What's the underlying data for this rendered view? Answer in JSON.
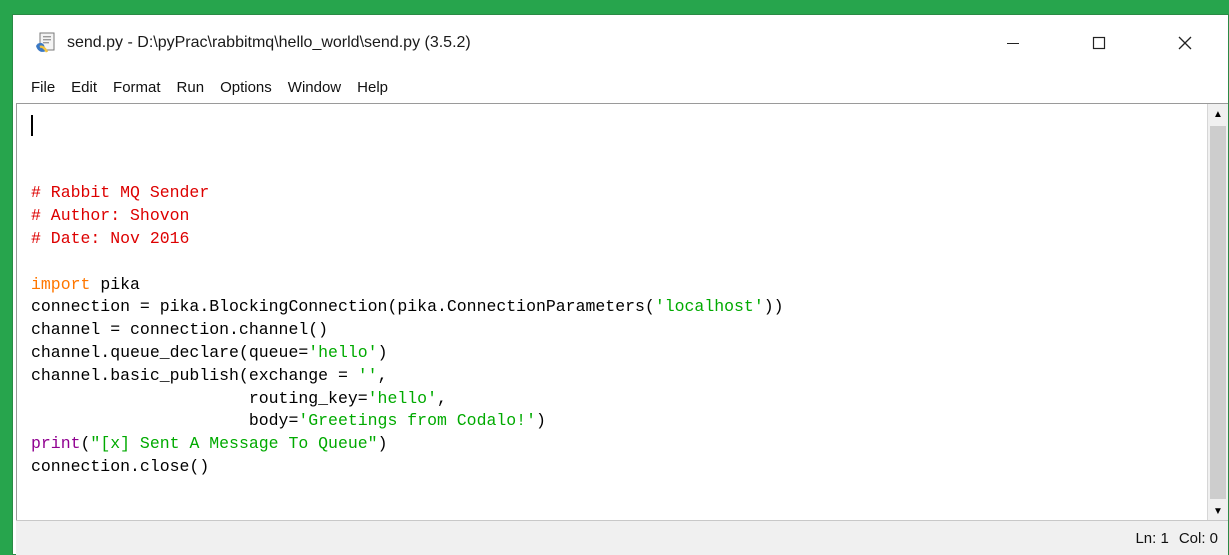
{
  "window": {
    "title": "send.py - D:\\pyPrac\\rabbitmq\\hello_world\\send.py (3.5.2)",
    "controls": {
      "minimize": "—",
      "maximize": "☐",
      "close": "✕"
    }
  },
  "menubar": {
    "items": [
      "File",
      "Edit",
      "Format",
      "Run",
      "Options",
      "Window",
      "Help"
    ]
  },
  "editor": {
    "lines": [
      [
        {
          "t": "# Rabbit MQ Sender",
          "c": "comment"
        }
      ],
      [
        {
          "t": "# Author: Shovon",
          "c": "comment"
        }
      ],
      [
        {
          "t": "# Date: Nov 2016",
          "c": "comment"
        }
      ],
      [
        {
          "t": "",
          "c": "plain"
        }
      ],
      [
        {
          "t": "import",
          "c": "keyword"
        },
        {
          "t": " pika",
          "c": "plain"
        }
      ],
      [
        {
          "t": "connection = pika.BlockingConnection(pika.ConnectionParameters(",
          "c": "plain"
        },
        {
          "t": "'localhost'",
          "c": "string"
        },
        {
          "t": "))",
          "c": "plain"
        }
      ],
      [
        {
          "t": "channel = connection.channel()",
          "c": "plain"
        }
      ],
      [
        {
          "t": "channel.queue_declare(queue=",
          "c": "plain"
        },
        {
          "t": "'hello'",
          "c": "string"
        },
        {
          "t": ")",
          "c": "plain"
        }
      ],
      [
        {
          "t": "channel.basic_publish(exchange = ",
          "c": "plain"
        },
        {
          "t": "''",
          "c": "string"
        },
        {
          "t": ",",
          "c": "plain"
        }
      ],
      [
        {
          "t": "                      routing_key=",
          "c": "plain"
        },
        {
          "t": "'hello'",
          "c": "string"
        },
        {
          "t": ",",
          "c": "plain"
        }
      ],
      [
        {
          "t": "                      body=",
          "c": "plain"
        },
        {
          "t": "'Greetings from Codalo!'",
          "c": "string"
        },
        {
          "t": ")",
          "c": "plain"
        }
      ],
      [
        {
          "t": "print",
          "c": "builtin"
        },
        {
          "t": "(",
          "c": "plain"
        },
        {
          "t": "\"[x] Sent A Message To Queue\"",
          "c": "string"
        },
        {
          "t": ")",
          "c": "plain"
        }
      ],
      [
        {
          "t": "connection.close()",
          "c": "plain"
        }
      ]
    ]
  },
  "scrollbar": {
    "up_arrow": "▲",
    "down_arrow": "▼"
  },
  "statusbar": {
    "line": "Ln: 1",
    "col": "Col: 0"
  },
  "colors": {
    "background": "#27a54d",
    "comment": "#dd0000",
    "keyword": "#ff7700",
    "builtin": "#900090",
    "string": "#00aa00"
  }
}
